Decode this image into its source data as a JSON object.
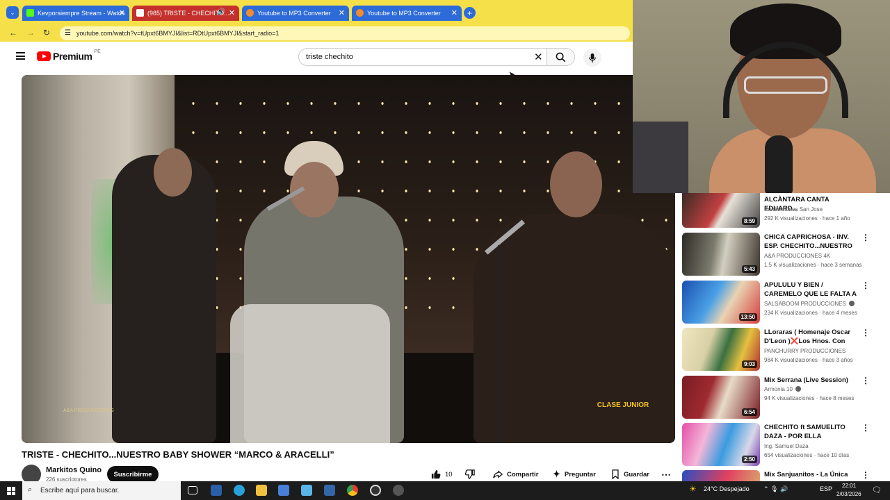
{
  "browser": {
    "tabs": [
      {
        "title": "Kevporsiempre Stream - Watch",
        "active": false
      },
      {
        "title": "(985) TRISTE - CHECHITO...",
        "active": true
      },
      {
        "title": "Youtube to MP3 Converter",
        "active": false
      },
      {
        "title": "Youtube to MP3 Converter",
        "active": false
      }
    ],
    "url": "youtube.com/watch?v=tUpxt6BMYJI&list=RDtUpxt6BMYJI&start_radio=1"
  },
  "youtube": {
    "logo_text": "Premium",
    "logo_region": "PE",
    "search_value": "triste chechito"
  },
  "video": {
    "title": "TRISTE - CHECHITO...NUESTRO BABY SHOWER “MARCO & ARACELLI”",
    "channel": "Markitos Quino",
    "subscribers": "226 suscriptores",
    "subscribe_label": "Suscribirme",
    "likes": "10",
    "share_label": "Compartir",
    "ask_label": "Preguntar",
    "save_label": "Guardar",
    "watermark_left": "A&A PRODUCCIONES",
    "watermark_right": "CLASE JUNIOR"
  },
  "recommendations": [
    {
      "title": "ALCÀNTARA CANTA EDUARD...",
      "channel": "Producciones San Jose",
      "meta": "292 K visualizaciones · hace 1 año",
      "duration": "8:59",
      "verified": false
    },
    {
      "title": "CHICA CAPRICHOSA - INV. ESP. CHECHITO...NUESTRO BABY ...",
      "channel": "A&A PRODUCCIONES 4K",
      "meta": "1,5 K visualizaciones · hace 3 semanas",
      "duration": "5:43",
      "verified": false
    },
    {
      "title": "APULULU Y BIEN / CAREMELO QUE LE FALTA A TU PIÑATA / ...",
      "channel": "SALSABOOM PRODUCCIONES",
      "meta": "234 K visualizaciones · hace 4 meses",
      "duration": "13:50",
      "verified": true
    },
    {
      "title": "LLoraras ( Homenaje Oscar D'Leon )❌Los Hnos. Con Sab...",
      "channel": "PANCHURRY PRODUCCIONES",
      "meta": "984 K visualizaciones · hace 3 años",
      "duration": "9:03",
      "verified": false
    },
    {
      "title": "Mix Serrana (Live Session)",
      "channel": "Armonia 10",
      "meta": "94 K visualizaciones · hace 8 meses",
      "duration": "6:54",
      "verified": true
    },
    {
      "title": "CHECHITO ft  SAMUELITO DAZA - POR ELLA",
      "channel": "Ing. Samuel Daza",
      "meta": "654 visualizaciones · hace 10 días",
      "duration": "2:50",
      "verified": false
    },
    {
      "title": "Mix Sanjuanitos - La Única",
      "channel": "",
      "meta": "",
      "duration": "",
      "verified": false
    }
  ],
  "taskbar": {
    "search_placeholder": "Escribe aquí para buscar.",
    "weather": "24°C  Despejado",
    "lang": "ESP",
    "time": "22:01",
    "date": "2/03/2026"
  },
  "colors": {
    "browser_accent": "#f6e04a",
    "active_tab": "#c4302b",
    "inactive_tab": "#2d6bd8",
    "youtube_red": "#ff0000"
  }
}
